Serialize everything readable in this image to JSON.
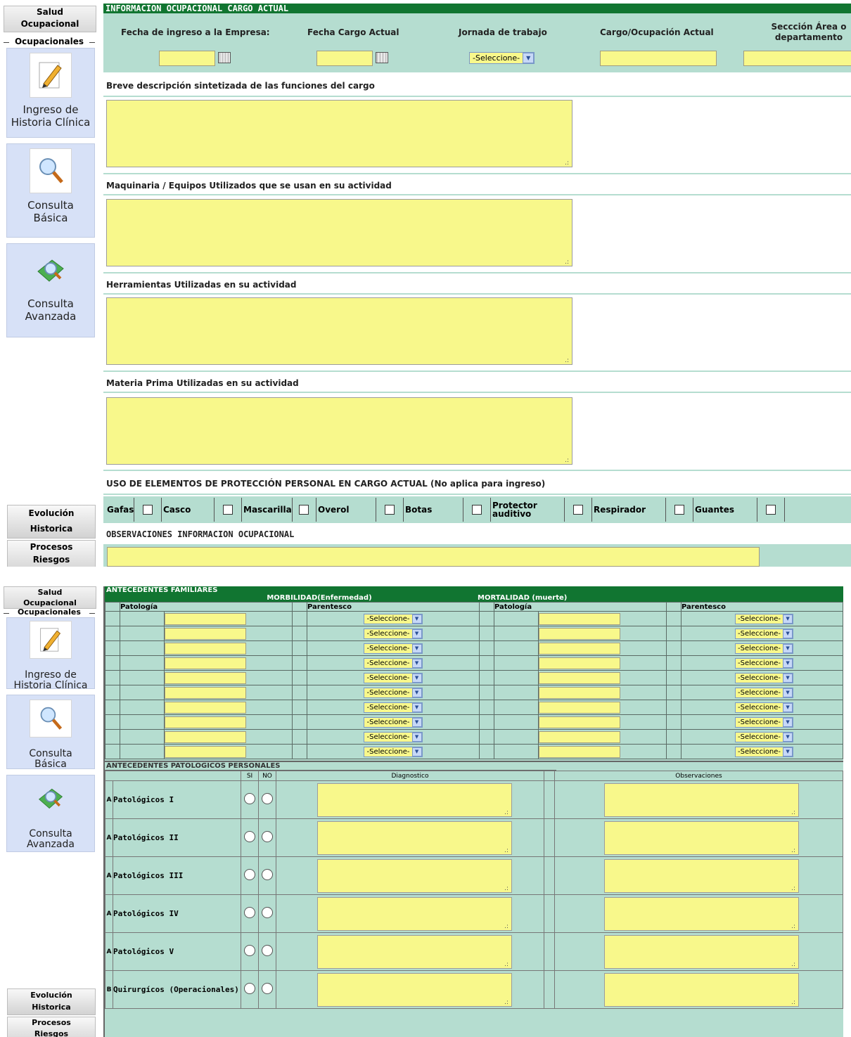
{
  "sidebar": {
    "title_line1": "Salud",
    "title_line2": "Ocupacional",
    "subtitle": "Ocupacionales",
    "items": [
      {
        "label_1": "Ingreso de",
        "label_2": "Historia Clínica",
        "icon": "pencil-icon"
      },
      {
        "label_1": "Consulta",
        "label_2": "Básica",
        "icon": "magnifier-icon"
      },
      {
        "label_1": "Consulta",
        "label_2": "Avanzada",
        "icon": "book-search-icon"
      }
    ],
    "footer": [
      {
        "line1": "Evolución",
        "line2": "Historica"
      },
      {
        "line1": "Procesos",
        "line2": "Riesgos"
      }
    ]
  },
  "ocupacional": {
    "header": "INFORMACION OCUPACIONAL CARGO ACTUAL",
    "fecha_ingreso_label": "Fecha de ingreso a la Empresa:",
    "fecha_cargo_label": "Fecha Cargo Actual",
    "jornada_label": "Jornada de trabajo",
    "jornada_value": "-Seleccione-",
    "cargo_label": "Cargo/Ocupación Actual",
    "seccion_label_1": "Seccción Área o",
    "seccion_label_2": "departamento",
    "descripcion_label": "Breve descripción sintetizada de las funciones del cargo",
    "maquinaria_label": "Maquinaria / Equipos Utilizados que se usan en su actividad",
    "herramientas_label": "Herramientas Utilizadas en su actividad",
    "materia_label": "Materia Prima Utilizadas en su actividad",
    "epp_label": "USO DE ELEMENTOS DE PROTECCIÓN PERSONAL EN CARGO ACTUAL (No aplica para ingreso)",
    "epp_items": [
      "Gafas",
      "Casco",
      "Mascarilla",
      "Overol",
      "Botas",
      "Protector auditivo",
      "Respirador",
      "Guantes"
    ],
    "observaciones_label": "OBSERVACIONES INFORMACION OCUPACIONAL"
  },
  "familiares": {
    "header": "ANTECEDENTES FAMILIARES",
    "morbilidad": "MORBILIDAD(Enfermedad)",
    "mortalidad": "MORTALIDAD (muerte)",
    "col_patologia": "Patología",
    "col_parentesco": "Parentesco",
    "select_value": "-Seleccione-",
    "row_count": 10
  },
  "personales": {
    "header": "ANTECEDENTES PATOLOGICOS PERSONALES",
    "col_si": "SI",
    "col_no": "NO",
    "col_diagnostico": "Diagnostico",
    "col_observaciones": "Observaciones",
    "rows": [
      {
        "code": "A",
        "label": "Patológicos I"
      },
      {
        "code": "A",
        "label": "Patológicos II"
      },
      {
        "code": "A",
        "label": "Patológicos III"
      },
      {
        "code": "A",
        "label": "Patológicos IV"
      },
      {
        "code": "A",
        "label": "Patológicos V"
      },
      {
        "code": "B",
        "label": "Quirurgícos (Operacionales)"
      }
    ]
  }
}
